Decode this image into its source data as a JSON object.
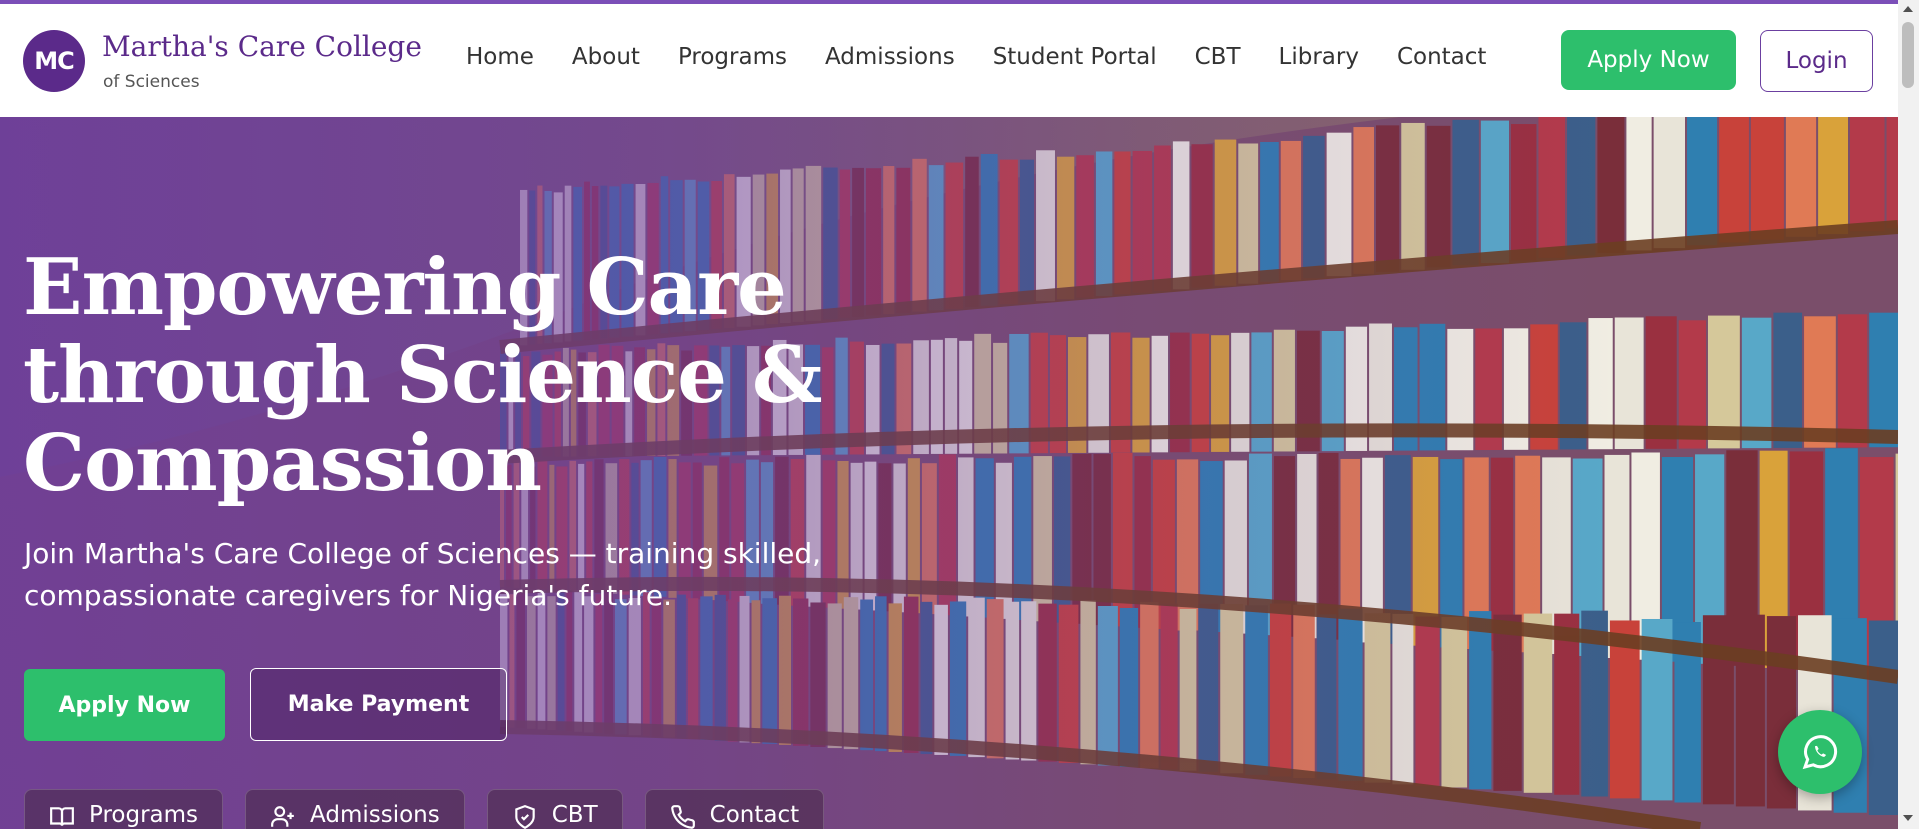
{
  "brand": {
    "logo_text": "MC",
    "name": "Martha's Care College",
    "subtitle": "of Sciences"
  },
  "nav": {
    "items": [
      "Home",
      "About",
      "Programs",
      "Admissions",
      "Student Portal",
      "CBT",
      "Library",
      "Contact"
    ],
    "apply_label": "Apply Now",
    "login_label": "Login"
  },
  "hero": {
    "title_lines": [
      "Empowering Care",
      "through Science &",
      "Compassion"
    ],
    "subtitle": "Join Martha's Care College of Sciences — training skilled, compassionate caregivers for Nigeria's future.",
    "apply_label": "Apply Now",
    "payment_label": "Make Payment",
    "quick_links": [
      {
        "label": "Programs",
        "icon": "book-icon"
      },
      {
        "label": "Admissions",
        "icon": "user-plus-icon"
      },
      {
        "label": "CBT",
        "icon": "shield-check-icon"
      },
      {
        "label": "Contact",
        "icon": "phone-icon"
      }
    ]
  },
  "colors": {
    "brand_purple": "#5b2a8a",
    "accent_green": "#2dbf6c",
    "top_border": "#7b4fb8"
  },
  "floating": {
    "icon": "whatsapp-icon"
  }
}
